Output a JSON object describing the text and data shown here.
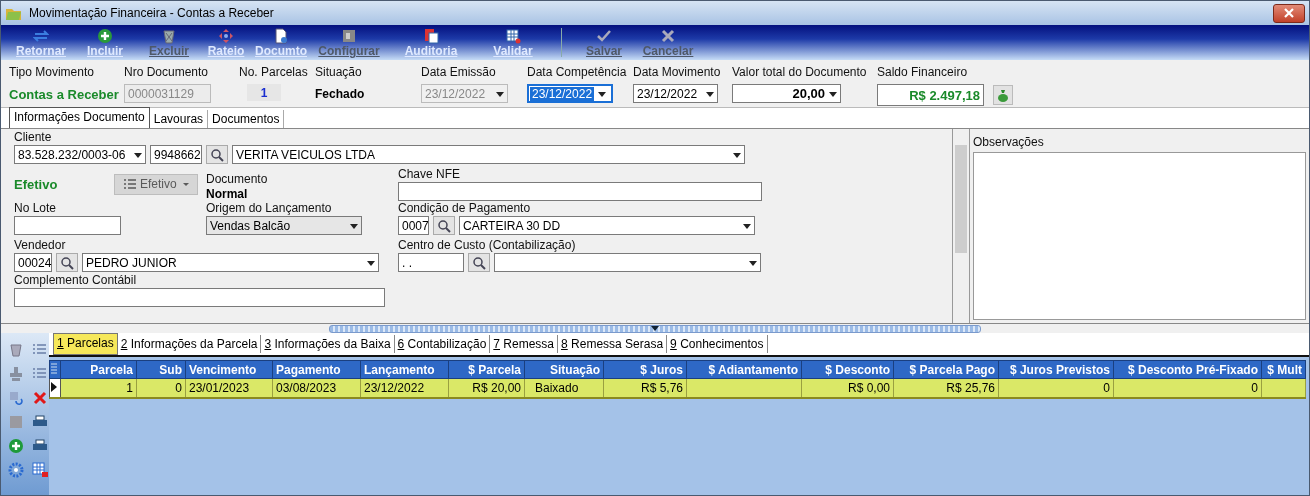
{
  "window": {
    "title": "Movimentação Financeira - Contas a Receber"
  },
  "toolbar": {
    "main": [
      {
        "label": "Retornar",
        "disabled": false
      },
      {
        "label": "Incluir",
        "disabled": false
      },
      {
        "label": "Excluir",
        "disabled": true
      },
      {
        "label": "Rateio",
        "disabled": false
      },
      {
        "label": "Documto",
        "disabled": false
      },
      {
        "label": "Configurar",
        "disabled": true
      },
      {
        "label": "Auditoria",
        "disabled": false
      },
      {
        "label": "Validar",
        "disabled": false
      }
    ],
    "edit": [
      {
        "label": "Salvar",
        "disabled": true
      },
      {
        "label": "Cancelar",
        "disabled": true
      }
    ]
  },
  "header_fields": [
    {
      "kind": "status",
      "label": "Tipo Movimento",
      "value": "Contas a Receber"
    },
    {
      "kind": "input",
      "label": "Nro Documento",
      "value": "0000031129",
      "disabled": true
    },
    {
      "kind": "count",
      "label": "No. Parcelas",
      "value": "1"
    },
    {
      "kind": "text",
      "label": "Situação",
      "value": "Fechado"
    },
    {
      "kind": "date",
      "label": "Data Emissão",
      "value": "23/12/2022",
      "disabled": true,
      "focused": false
    },
    {
      "kind": "date",
      "label": "Data Competência",
      "value": "23/12/2022",
      "disabled": false,
      "focused": true
    },
    {
      "kind": "date",
      "label": "Data Movimento",
      "value": "23/12/2022",
      "disabled": false,
      "focused": false
    },
    {
      "kind": "amount",
      "label": "Valor total do Documento",
      "value": "20,00"
    },
    {
      "kind": "balance",
      "label": "Saldo Financeiro",
      "value": "R$ 2.497,18"
    }
  ],
  "tabs": [
    {
      "label": "Informações Documento",
      "selected": true
    },
    {
      "label": "Lavouras",
      "selected": false
    },
    {
      "label": "Documentos",
      "selected": false
    }
  ],
  "form": {
    "cliente": {
      "label": "Cliente",
      "document": "83.528.232/0003-06",
      "code": "9948662",
      "name": "VERITA VEICULOS LTDA"
    },
    "efetivo": {
      "status": "Efetivo",
      "button": "Efetivo",
      "disabled": true
    },
    "documento": {
      "label": "Documento",
      "value": "Normal"
    },
    "chave_nfe": {
      "label": "Chave NFE"
    },
    "no_lote": {
      "label": "No Lote"
    },
    "origem": {
      "label": "Origem do Lançamento",
      "value": "Vendas Balcão"
    },
    "condicao": {
      "label": "Condição de Pagamento",
      "code": "0007",
      "name": "CARTEIRA 30 DD"
    },
    "vendedor": {
      "label": "Vendedor",
      "code": "00024",
      "name": "PEDRO JUNIOR"
    },
    "centro_custo": {
      "label": "Centro de Custo (Contabilização)",
      "code": " .  ."
    },
    "complemento": {
      "label": "Complemento Contábil"
    }
  },
  "observacoes": {
    "label": "Observações"
  },
  "bottom_tabs": [
    {
      "number": "1",
      "label": "Parcelas",
      "selected": true
    },
    {
      "number": "2",
      "label": "Informações da Parcela",
      "selected": false
    },
    {
      "number": "3",
      "label": "Informações da Baixa",
      "selected": false
    },
    {
      "number": "6",
      "label": "Contabilização",
      "selected": false
    },
    {
      "number": "7",
      "label": "Remessa",
      "selected": false
    },
    {
      "number": "8",
      "label": "Remessa Serasa",
      "selected": false
    },
    {
      "number": "9",
      "label": "Conhecimentos",
      "selected": false
    }
  ],
  "table": {
    "columns": [
      "Parcela",
      "Sub",
      "Vencimento",
      "Pagamento",
      "Lançamento",
      "$ Parcela",
      "Situação",
      "$ Juros",
      "$ Adiantamento",
      "$ Desconto",
      "$ Parcela Pago",
      "$ Juros Previstos",
      "$ Desconto Pré-Fixado",
      "$ Mult"
    ],
    "rows": [
      {
        "selected": true,
        "cells": [
          "1",
          "0",
          "23/01/2023",
          "03/08/2023",
          "23/12/2022",
          "R$ 20,00",
          "Baixado",
          "R$ 5,76",
          "",
          "R$ 0,00",
          "R$ 25,76",
          "0",
          "0",
          ""
        ]
      }
    ]
  }
}
